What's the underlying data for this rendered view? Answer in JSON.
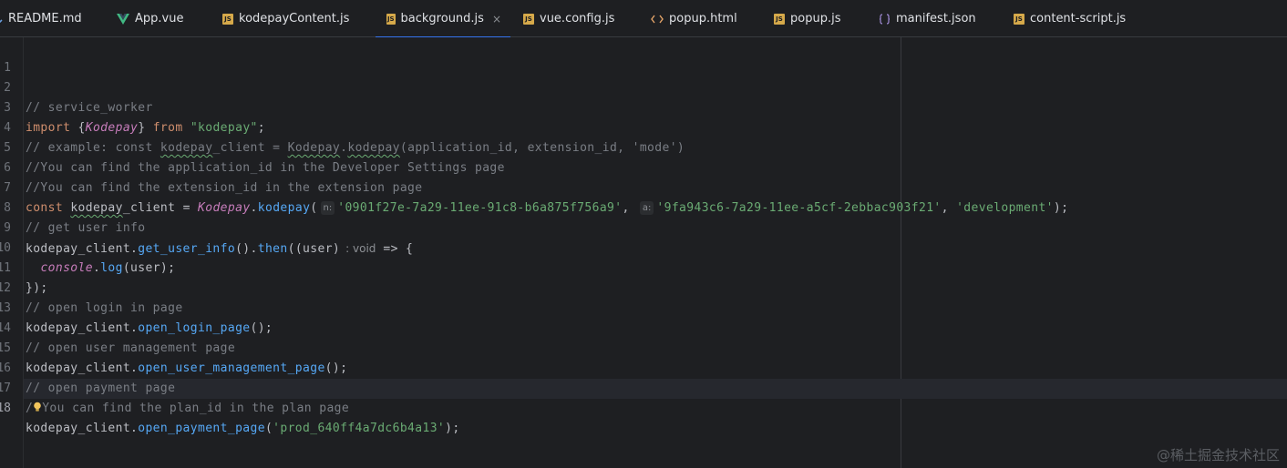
{
  "tabs": [
    {
      "label": "README.md",
      "icon": "markdown-icon",
      "active": false
    },
    {
      "label": "App.vue",
      "icon": "vue-icon",
      "active": false
    },
    {
      "label": "kodepayContent.js",
      "icon": "js-file-icon",
      "active": false
    },
    {
      "label": "background.js",
      "icon": "js-file-icon",
      "active": true
    },
    {
      "label": "vue.config.js",
      "icon": "js-file-icon",
      "active": false
    },
    {
      "label": "popup.html",
      "icon": "html-icon",
      "active": false
    },
    {
      "label": "popup.js",
      "icon": "js-file-icon",
      "active": false
    },
    {
      "label": "manifest.json",
      "icon": "json-icon",
      "active": false
    },
    {
      "label": "content-script.js",
      "icon": "js-file-icon",
      "active": false
    }
  ],
  "tab_close_glyph": "×",
  "js_icon_text": "JS",
  "line_numbers": [
    "1",
    "2",
    "3",
    "4",
    "5",
    "6",
    "7",
    "8",
    "9",
    "10",
    "11",
    "12",
    "13",
    "14",
    "15",
    "16",
    "17",
    "18"
  ],
  "code": {
    "l2": "// service_worker",
    "l3": {
      "kw1": "import",
      "p1": " {",
      "cls": "Kodepay",
      "p2": "} ",
      "kw2": "from",
      "p3": " ",
      "str": "\"kodepay\"",
      "p4": ";"
    },
    "l4": {
      "a": "// example: const ",
      "b": "kodepay",
      "c": "_client = ",
      "d": "Kodepay",
      "e": ".",
      "f": "kodepay",
      "g": "(application_id, extension_id, 'mode')"
    },
    "l5": "//You can find the application_id in the Developer Settings page",
    "l6": "//You can find the extension_id in the extension page",
    "l7": {
      "kw": "const",
      "a": " ",
      "b": "kodepay",
      "c": "_client = ",
      "cls": "Kodepay",
      "d": ".",
      "fn": "kodepay",
      "e": "(",
      "hint1": "n:",
      "str1": "'0901f27e-7a29-11ee-91c8-b6a875f756a9'",
      "f": ", ",
      "hint2": "a:",
      "str2": "'9fa943c6-7a29-11ee-a5cf-2ebbac903f21'",
      "g": ", ",
      "str3": "'development'",
      "h": ");"
    },
    "l8": "// get user info",
    "l9": {
      "a": "kodepay_client.",
      "fn1": "get_user_info",
      "b": "().",
      "fn2": "then",
      "c": "((user)",
      "type": ": void",
      "d": "=> {"
    },
    "l10": {
      "indent": "  ",
      "a": "console",
      "b": ".",
      "fn": "log",
      "c": "(user);"
    },
    "l11": "});",
    "l12": "// open login in page",
    "l13": {
      "a": "kodepay_client.",
      "fn": "open_login_page",
      "b": "();"
    },
    "l14": "// open user management page",
    "l15": {
      "a": "kodepay_client.",
      "fn": "open_user_management_page",
      "b": "();"
    },
    "l16": "// open payment page",
    "l17": {
      "a": "/",
      "b": "You can find the plan_id in the plan page"
    },
    "l18": {
      "a": "kodepay_client.",
      "fn": "open_payment_page",
      "b": "(",
      "str": "'prod_640ff4a7dc6b4a13'",
      "c": ");"
    }
  },
  "watermark": "@稀土掘金技术社区",
  "colors": {
    "background": "#1e1f22",
    "comment": "#7a7e85",
    "keyword": "#cf8e6d",
    "string": "#6aab73",
    "function": "#56a8f5",
    "class": "#c77dbb",
    "text": "#bcbec4",
    "accent": "#3574f0"
  }
}
